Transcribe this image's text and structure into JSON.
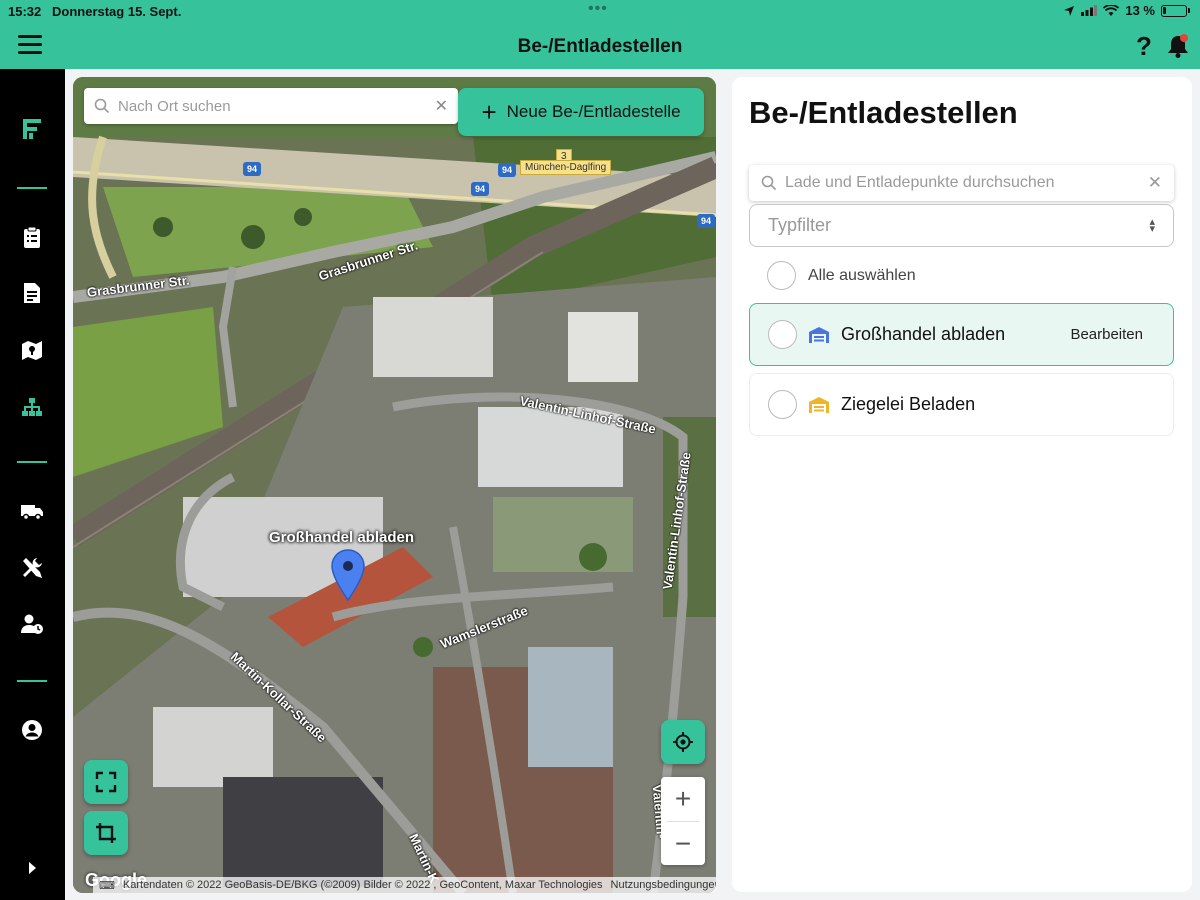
{
  "status_bar": {
    "time": "15:32",
    "date": "Donnerstag 15. Sept.",
    "battery_percent": "13 %",
    "battery_level": 0.13
  },
  "header": {
    "title": "Be-/Entladestellen",
    "help_label": "?"
  },
  "sidenav": {
    "logo": "F",
    "items": [
      {
        "name": "orders",
        "icon": "clipboard-icon"
      },
      {
        "name": "documents",
        "icon": "document-icon"
      },
      {
        "name": "map",
        "icon": "map-icon"
      },
      {
        "name": "locations",
        "icon": "sitemap-icon",
        "active": true
      },
      {
        "name": "trucks",
        "icon": "truck-icon"
      },
      {
        "name": "tools",
        "icon": "tools-icon"
      },
      {
        "name": "drivers",
        "icon": "user-clock-icon"
      },
      {
        "name": "account",
        "icon": "user-circle-icon"
      }
    ]
  },
  "map": {
    "search_placeholder": "Nach Ort suchen",
    "new_button_label": "Neue Be-/Entladestelle",
    "marker_label": "Großhandel abladen",
    "street_labels": {
      "grasbrunner_1": "Grasbrunner Str.",
      "grasbrunner_2": "Grasbrunner Str.",
      "valentin_1": "Valentin-Linhof-Straße",
      "valentin_2": "Valentin-Linhof-Straße",
      "valentin_3": "Valentin-",
      "wamsler": "Wamslerstraße",
      "martin_1": "Martin-Kollar-Straße",
      "martin_2": "Martin-K"
    },
    "highway_shields": [
      "94",
      "94",
      "94",
      "94",
      "3"
    ],
    "exit_label": "München-Daglfing",
    "attribution": "Kartendaten © 2022 GeoBasis-DE/BKG (©2009) Bilder © 2022 , GeoContent, Maxar Technologies",
    "terms": "Nutzungsbedingungen",
    "google_logo": "Google",
    "zoom_in": "+",
    "zoom_out": "−"
  },
  "panel": {
    "title": "Be-/Entladestellen",
    "search_placeholder": "Lade und Entladepunkte durchsuchen",
    "type_filter_placeholder": "Typfilter",
    "select_all_label": "Alle auswählen",
    "items": [
      {
        "name": "Großhandel abladen",
        "icon_color": "#4a74e0",
        "edit_label": "Bearbeiten",
        "selected": true
      },
      {
        "name": "Ziegelei Beladen",
        "icon_color": "#f0b429",
        "selected": false
      }
    ]
  },
  "colors": {
    "accent": "#36c39c",
    "marker": "#4a80f0"
  }
}
